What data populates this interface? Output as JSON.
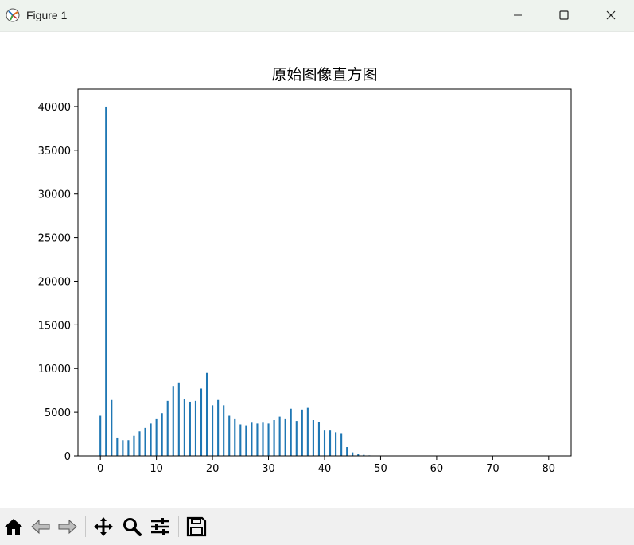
{
  "window": {
    "title": "Figure 1",
    "controls": [
      "minimize-icon",
      "maximize-icon",
      "close-icon"
    ]
  },
  "toolbar": {
    "tools": [
      "home-icon",
      "back-arrow-icon",
      "forward-arrow-icon",
      "pan-move-icon",
      "zoom-magnifier-icon",
      "configure-subplots-icon",
      "save-floppy-icon"
    ]
  },
  "colors": {
    "bar": "#1f77b4",
    "titlebar": "#eef3ee",
    "toolbar": "#f0f0f0"
  },
  "chart_data": {
    "type": "bar",
    "title": "原始图像直方图",
    "xlabel": "",
    "ylabel": "",
    "xlim": [
      -4,
      84
    ],
    "ylim": [
      0,
      42000
    ],
    "xticks": [
      0,
      10,
      20,
      30,
      40,
      50,
      60,
      70,
      80
    ],
    "yticks": [
      0,
      5000,
      10000,
      15000,
      20000,
      25000,
      30000,
      35000,
      40000
    ],
    "grid": false,
    "x": [
      0,
      1,
      2,
      3,
      4,
      5,
      6,
      7,
      8,
      9,
      10,
      11,
      12,
      13,
      14,
      15,
      16,
      17,
      18,
      19,
      20,
      21,
      22,
      23,
      24,
      25,
      26,
      27,
      28,
      29,
      30,
      31,
      32,
      33,
      34,
      35,
      36,
      37,
      38,
      39,
      40,
      41,
      42,
      43,
      44,
      45,
      46,
      47,
      48
    ],
    "values": [
      4600,
      40000,
      6400,
      2100,
      1800,
      1800,
      2300,
      2800,
      3200,
      3700,
      4200,
      4900,
      6300,
      8000,
      8400,
      6500,
      6200,
      6300,
      7700,
      9500,
      5800,
      6400,
      5800,
      4600,
      4200,
      3600,
      3500,
      3800,
      3700,
      3800,
      3700,
      4100,
      4500,
      4200,
      5400,
      4000,
      5300,
      5500,
      4100,
      3900,
      2900,
      2900,
      2700,
      2600,
      1000,
      400,
      250,
      120,
      60
    ]
  }
}
